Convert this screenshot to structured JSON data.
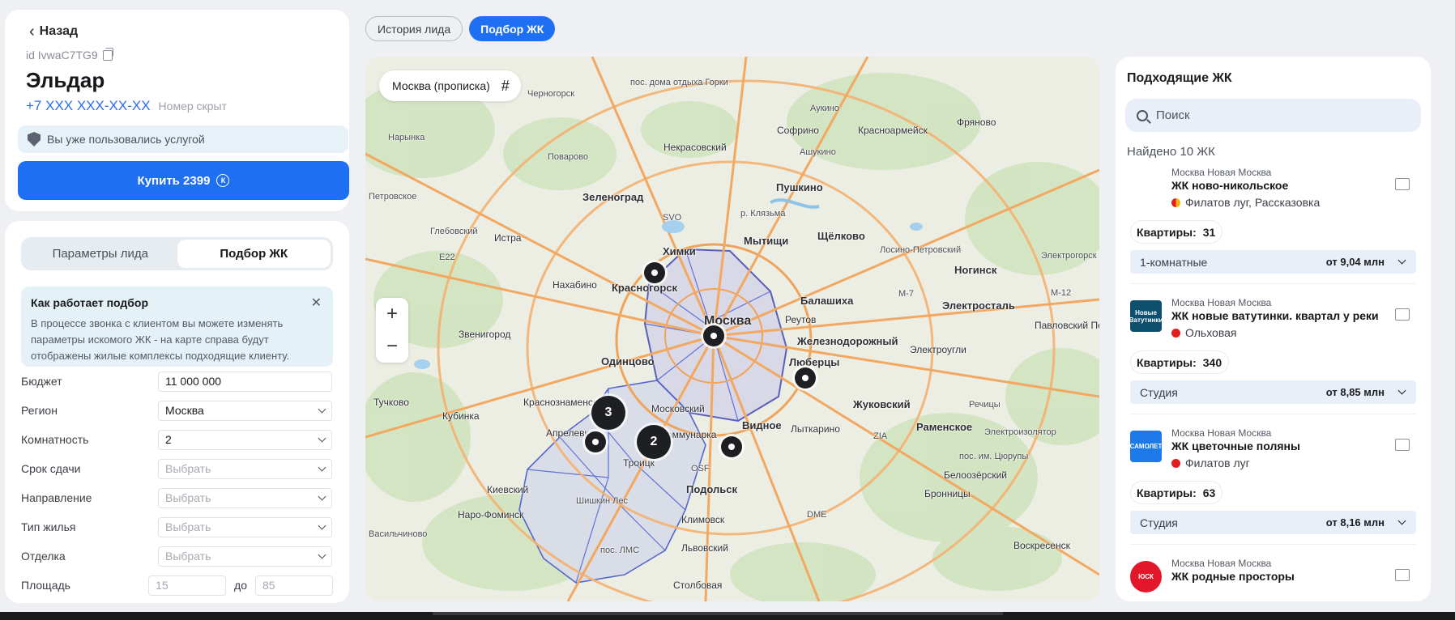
{
  "lead": {
    "back_label": "Назад",
    "id": "id IvwaC7TG9",
    "name": "Эльдар",
    "phone": "+7 XXX XXX-XX-XX",
    "phone_note": "Номер скрыт",
    "used_service": "Вы уже пользовались услугой",
    "buy_label": "Купить 2399",
    "coin": "К"
  },
  "params": {
    "tabs": [
      "Параметры лида",
      "Подбор ЖК"
    ],
    "info": {
      "title": "Как работает подбор",
      "text": "В процессе звонка с клиентом вы можете изменять параметры искомого ЖК - на карте справа будут отображены жилые комплексы подходящие клиенту."
    },
    "fields": [
      {
        "label": "Бюджет",
        "value": "11 000 000"
      },
      {
        "label": "Регион",
        "value": "Москва"
      },
      {
        "label": "Комнатность",
        "value": "2"
      },
      {
        "label": "Срок сдачи",
        "value": "Выбрать"
      },
      {
        "label": "Направление",
        "value": "Выбрать"
      },
      {
        "label": "Тип жилья",
        "value": "Выбрать"
      },
      {
        "label": "Отделка",
        "value": "Выбрать"
      }
    ],
    "area": {
      "label": "Площадь",
      "from": "15",
      "to_label": "до",
      "to": "85"
    }
  },
  "top_tabs": [
    "История лида",
    "Подбор ЖК"
  ],
  "map": {
    "region": "Москва (прописка)",
    "zoom_in": "+",
    "zoom_out": "−",
    "clusters": [
      "3",
      "2"
    ],
    "labels": {
      "moscow": "Москва",
      "zelenograd": "Зеленоград",
      "khimki": "Химки",
      "mytishchi": "Мытищи",
      "pushkino": "Пушкино",
      "shchyolkovo": "Щёлково",
      "krasnogorsk": "Красногорск",
      "balashikha": "Балашиха",
      "reutov": "Реутов",
      "zheleznodorozhny": "Железнодорожный",
      "lyubertsy": "Люберцы",
      "odintsovo": "Одинцово",
      "zhukovsky": "Жуковский",
      "vidnoe": "Видное",
      "podolsk": "Подольск",
      "troitsk": "Троицк",
      "kommunarka": "Коммунарка",
      "moskovsky": "Московский",
      "krasnoznamensk": "Краснознаменск",
      "aprelevka": "Апрелевка",
      "kubinka": "Кубинка",
      "tuchkovo": "Тучково",
      "lytkarino": "Лыткарино",
      "ramenskoe": "Раменское",
      "noginsk": "Ногинск",
      "elektrostal": "Электросталь",
      "elektrougli": "Электроугли",
      "pavlovsky_posad": "Павловский Посад",
      "fryanovo": "Фряново",
      "krasnoarmeysk": "Красноармейск",
      "sofrino": "Софрино",
      "nekrasovsky": "Некрасовский",
      "istra": "Истра",
      "nakhabino": "Нахабино",
      "zvenigorod": "Звенигород",
      "kievsky": "Киевский",
      "naro_fominsk": "Наро-Фоминск",
      "klimovsk": "Климовск",
      "lvovsky": "Львовский",
      "stolbovaya": "Столбовая",
      "voskresensk": "Воскресенск",
      "bronnitsy": "Бронницы",
      "beloozersky": "Белоозёрский",
      "shishkin_les": "Шишкин Лес",
      "lms": "пос. ЛМС",
      "vasilchinovo": "Васильчиново",
      "chernogorsk": "Черногорск",
      "solnechnaya_gora": "пос. дома отдыха Горки",
      "povarovo": "Поварово",
      "aukino": "Аукино",
      "ashukino": "Ашукино",
      "narynka": "Нарынка",
      "glebovsky": "Глебовский",
      "petrovskoe": "Петровское",
      "losino": "Лосино-Петровский",
      "elektrogorsk": "Электрогорск",
      "rechitsy": "Речицы",
      "elektroizolyator": "Электроизолятор",
      "tsyurupy": "пос. им. Цюрупы",
      "svo": "SVO",
      "dme": "DME",
      "zia": "ZIA",
      "osf": "OSF",
      "e22": "E22",
      "m7": "M-7",
      "m12": "M-12",
      "klyazma": "р. Клязьма"
    }
  },
  "results": {
    "title": "Подходящие ЖК",
    "search_placeholder": "Поиск",
    "found": "Найдено 10 ЖК",
    "items": [
      {
        "region": "Москва Новая Москва",
        "name": "ЖК ново-никольское",
        "metro": "Филатов луг, Рассказовка",
        "metro_color": "duo",
        "logo_text": "",
        "logo_color": "#ffffff",
        "flats_label": "Квартиры:",
        "flats_count": "31",
        "offer_type": "1-комнатные",
        "offer_price": "от 9,04 млн"
      },
      {
        "region": "Москва Новая Москва",
        "name": "ЖК новые ватутинки. квартал у реки",
        "metro": "Ольховая",
        "metro_color": "red",
        "logo_text": "Новые Ватутинки",
        "logo_color": "#0f4f6e",
        "flats_label": "Квартиры:",
        "flats_count": "340",
        "offer_type": "Студия",
        "offer_price": "от 8,85 млн"
      },
      {
        "region": "Москва Новая Москва",
        "name": "ЖК цветочные поляны",
        "metro": "Филатов луг",
        "metro_color": "red",
        "logo_text": "САМОЛЕТ",
        "logo_color": "#1d7ae8",
        "flats_label": "Квартиры:",
        "flats_count": "63",
        "offer_type": "Студия",
        "offer_price": "от 8,16 млн"
      },
      {
        "region": "Москва Новая Москва",
        "name": "ЖК родные просторы",
        "metro": "",
        "metro_color": "red",
        "logo_text": "ЮСК",
        "logo_color": "#e2182a",
        "flats_label": "",
        "flats_count": "",
        "offer_type": "",
        "offer_price": ""
      }
    ]
  }
}
